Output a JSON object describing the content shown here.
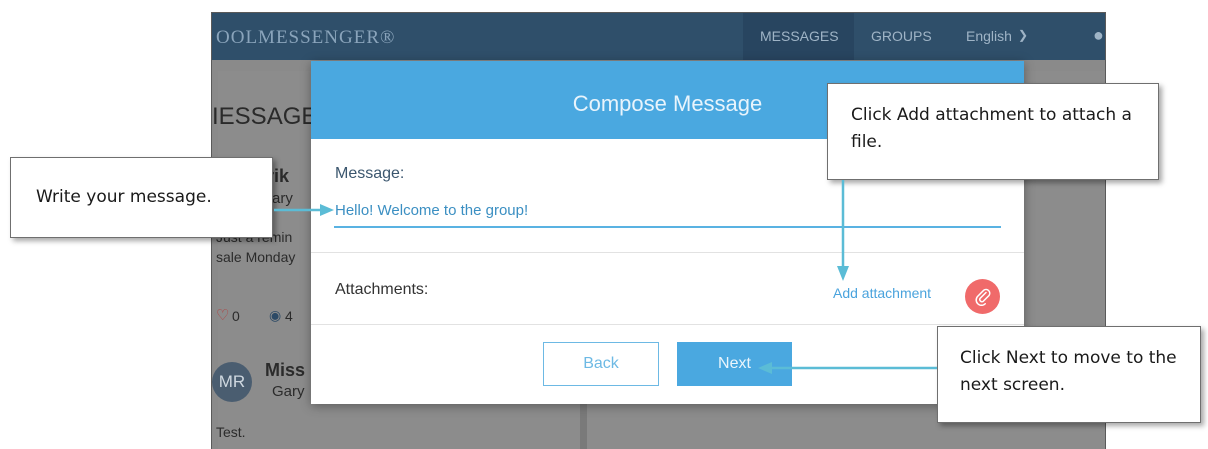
{
  "app": {
    "brand": "OOLMESSENGER®",
    "nav": {
      "messages": "MESSAGES",
      "groups": "GROUPS",
      "language": "English"
    },
    "left_panel": {
      "heading": "IESSAGES",
      "item1_name": "erik",
      "item1_sub": "ary",
      "item1_preview_line1": "Just a remin",
      "item1_preview_line2": "sale Monday",
      "likes": "0",
      "comments": "4",
      "item2_avatar": "MR",
      "item2_name": "Miss",
      "item2_sub": "Gary",
      "item2_text": "Test."
    }
  },
  "dialog": {
    "title": "Compose Message",
    "message_label": "Message:",
    "message_value": "Hello! Welcome to the group!",
    "attachments_label": "Attachments:",
    "add_attachment": "Add attachment",
    "back_label": "Back",
    "next_label": "Next"
  },
  "callouts": {
    "write": "Write your message.",
    "attach": "Click Add attachment to attach a file.",
    "next": "Click Next to move to the next screen."
  },
  "icons": {
    "chevron": "chevron-down-icon",
    "user": "user-icon",
    "heart": "heart-icon",
    "comment": "comment-icon",
    "paperclip": "paperclip-icon"
  },
  "colors": {
    "header_blue": "#4aa8e0",
    "topbar": "#2f4f6a",
    "clip_red": "#f06a6a",
    "arrow": "#5bbcd6"
  }
}
